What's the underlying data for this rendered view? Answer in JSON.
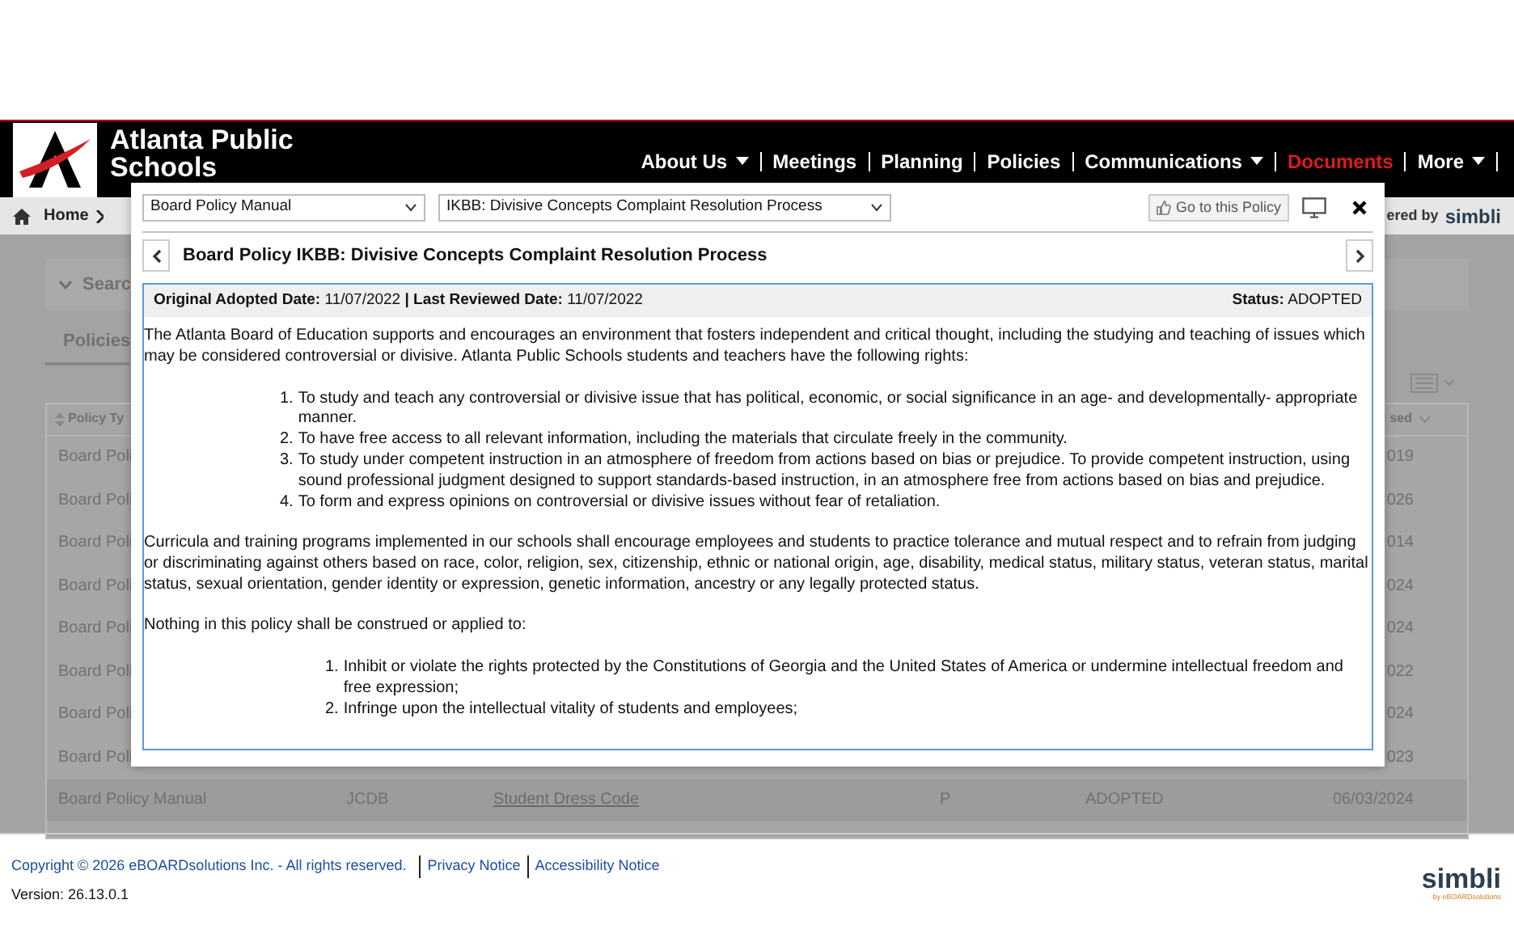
{
  "header": {
    "title_lines": [
      "Atlanta Public",
      "Schools"
    ],
    "nav": [
      {
        "label": "About Us",
        "dropdown": true,
        "selected": false
      },
      {
        "label": "Meetings",
        "dropdown": false,
        "selected": false
      },
      {
        "label": "Planning",
        "dropdown": false,
        "selected": false
      },
      {
        "label": "Policies",
        "dropdown": false,
        "selected": false
      },
      {
        "label": "Communications",
        "dropdown": true,
        "selected": false
      },
      {
        "label": "Documents",
        "dropdown": false,
        "selected": true
      },
      {
        "label": "More",
        "dropdown": true,
        "selected": false
      }
    ]
  },
  "breadcrumb": {
    "home": "Home",
    "powered_by": "ered by",
    "brand": "simbli"
  },
  "background_page": {
    "search_label": "Searc",
    "tab": "Policies",
    "table": {
      "column_1_header": "Policy Ty",
      "last_column_header": "sed",
      "rows": [
        {
          "column_1": "Board Poli",
          "last_column": "019"
        },
        {
          "column_1": "Board Poli",
          "last_column": "026"
        },
        {
          "column_1": "Board Poli",
          "last_column": "014"
        },
        {
          "column_1": "Board Poli",
          "last_column": "024"
        },
        {
          "column_1": "Board Poli",
          "last_column": "024"
        },
        {
          "column_1": "Board Poli",
          "last_column": "022"
        },
        {
          "column_1": "Board Poli",
          "last_column": "024"
        },
        {
          "column_1": "Board Poli",
          "last_column": "023"
        }
      ],
      "full_row": {
        "policy_type": "Board Policy Manual",
        "code": "JCDB",
        "title": "Student Dress Code",
        "column_4": "P",
        "status": "ADOPTED",
        "date": "06/03/2024"
      }
    }
  },
  "modal": {
    "manual_select": "Board Policy Manual",
    "policy_select": "IKBB: Divisive Concepts Complaint Resolution Process",
    "go_button": "Go to this Policy",
    "title": "Board Policy IKBB: Divisive Concepts Complaint Resolution Process",
    "dates": "**Original Adopted Date:** 11/07/2022 **| Last Reviewed Date:** 11/07/2022",
    "status": "**Status:** ADOPTED",
    "body": [
      {
        "kind": "paragraph",
        "text": "The Atlanta Board of Education supports and encourages an environment that fosters independent and critical thought, including the studying and teaching of issues which may be considered controversial or divisive. Atlanta Public Schools students and teachers have the following rights:"
      },
      {
        "kind": "list",
        "items": [
          {
            "number": "1.",
            "text": "To study and teach any controversial or divisive issue that has political, economic, or social significance in an age- and developmentally- appropriate manner."
          },
          {
            "number": "2.",
            "text": "To have free access to all relevant information, including the materials that circulate freely in the community."
          },
          {
            "number": "3.",
            "text": "To study under competent instruction in an atmosphere of freedom from actions based on bias or prejudice. To provide competent instruction, using sound professional judgment designed to support standards-based instruction, in an atmosphere free from actions based on bias and prejudice."
          },
          {
            "number": "4.",
            "text": "To form and express opinions on controversial or divisive issues without fear of retaliation."
          }
        ]
      },
      {
        "kind": "paragraph",
        "text": "Curricula and training programs implemented in our schools shall encourage employees and students to practice tolerance and mutual respect and to refrain from judging or discriminating against others based on race, color, religion, sex, citizenship, ethnic or national origin, age, disability, medical status, military status, veteran status, marital status, sexual orientation, gender identity or expression, genetic information, ancestry or any legally protected status."
      },
      {
        "kind": "paragraph",
        "text": "Nothing in this policy shall be construed or applied to:"
      },
      {
        "kind": "list",
        "items": [
          {
            "number": "1.",
            "text": "Inhibit or violate the rights protected by the Constitutions of Georgia and the United States of America or undermine intellectual freedom and free expression;"
          },
          {
            "number": "2.",
            "text": "Infringe upon the intellectual vitality of students and employees;"
          }
        ]
      }
    ]
  },
  "footer": {
    "copyright": "Copyright © 2026 eBOARDsolutions Inc. - All rights reserved.",
    "links": [
      "Privacy Notice",
      "Accessibility Notice"
    ],
    "version": "Version: 26.13.0.1",
    "brand": "simbli",
    "brand_sub": "by eBOARDsolutions"
  }
}
